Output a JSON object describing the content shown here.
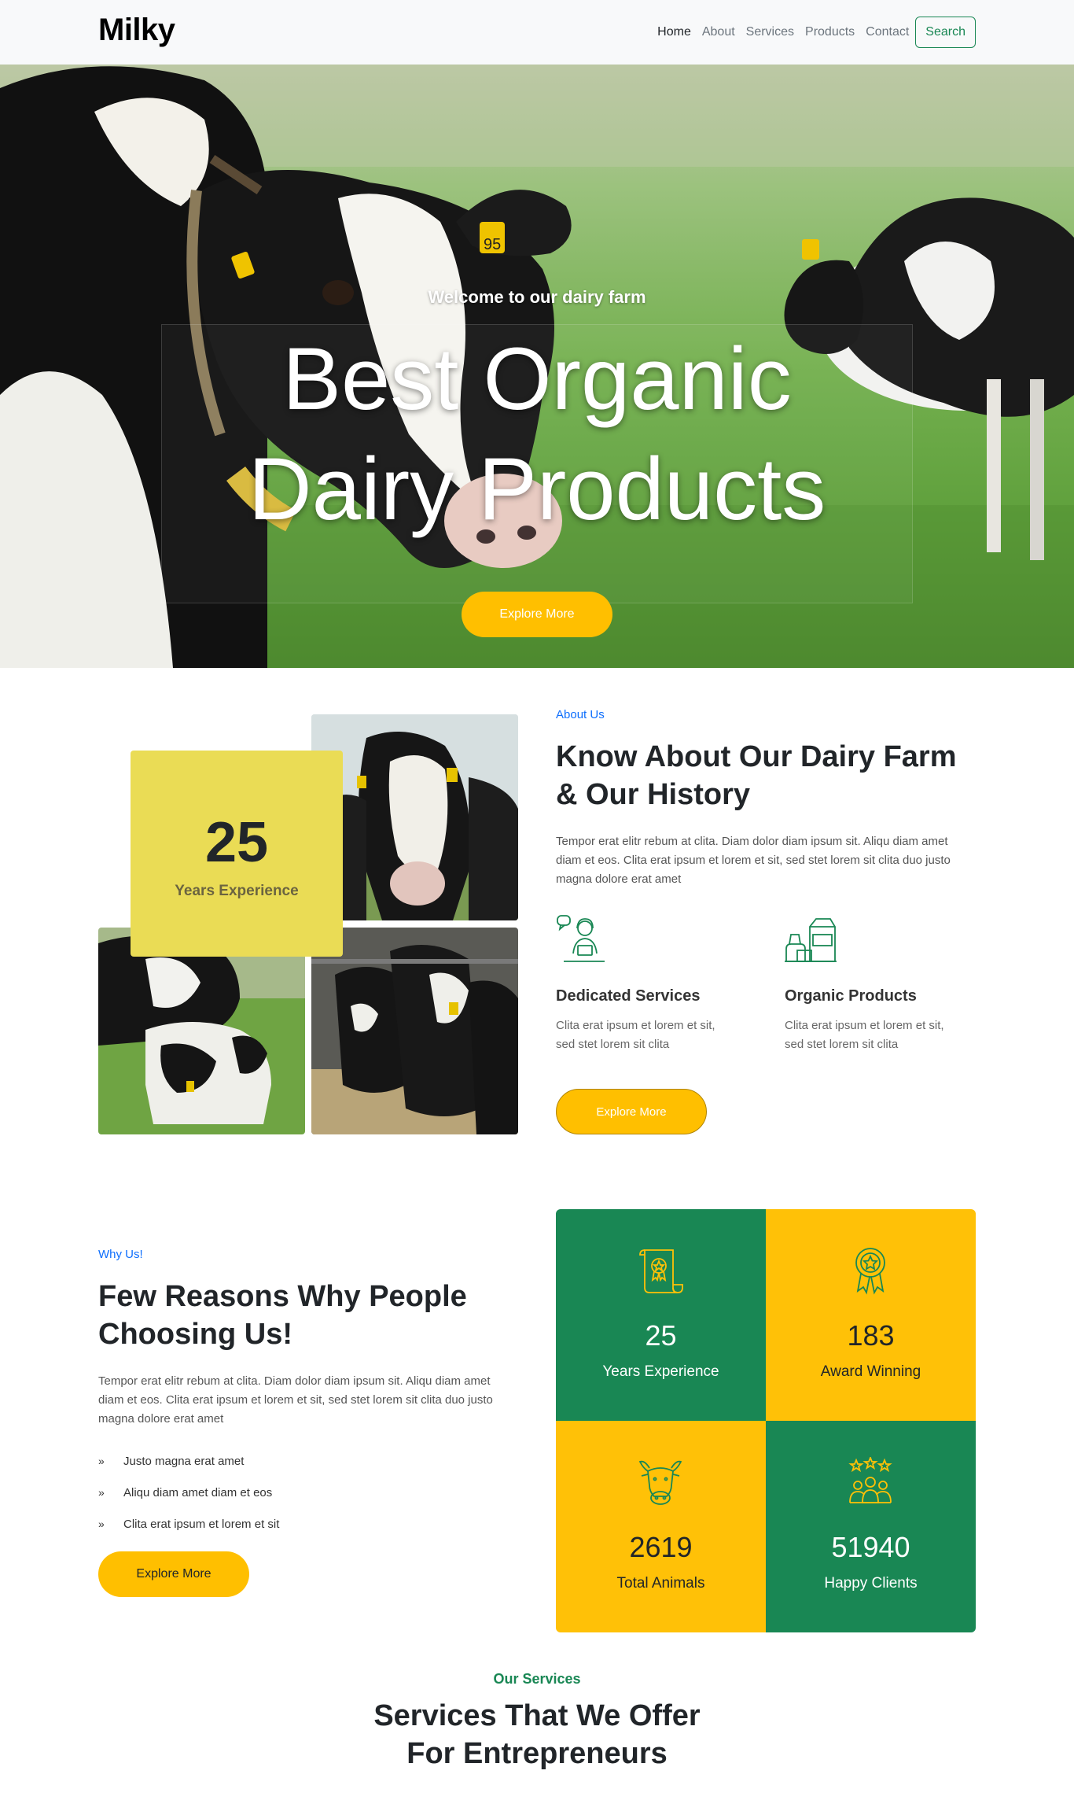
{
  "nav": {
    "brand": "Milky",
    "links": [
      "Home",
      "About",
      "Services",
      "Products",
      "Contact"
    ],
    "search_label": "Search"
  },
  "hero": {
    "subtitle": "Welcome to our dairy farm",
    "title_line1": "Best Organic",
    "title_line2": "Dairy Products",
    "button": "Explore More",
    "ear_tag_text": "95"
  },
  "about": {
    "tag": "About Us",
    "title_line1": "Know About Our Dairy Farm",
    "title_line2": "& Our History",
    "text": "Tempor erat elitr rebum at clita. Diam dolor diam ipsum sit. Aliqu diam amet diam et eos. Clita erat ipsum et lorem et sit, sed stet lorem sit clita duo justo magna dolore erat amet",
    "experience_number": "25",
    "experience_label": "Years Experience",
    "features": [
      {
        "title": "Dedicated Services",
        "text": "Clita erat ipsum et lorem et sit, sed stet lorem sit clita",
        "icon": "customer-support-icon"
      },
      {
        "title": "Organic Products",
        "text": "Clita erat ipsum et lorem et sit, sed stet lorem sit clita",
        "icon": "dairy-products-icon"
      }
    ],
    "button": "Explore More"
  },
  "why": {
    "tag": "Why Us!",
    "title_line1": "Few Reasons Why People",
    "title_line2": "Choosing Us!",
    "text": "Tempor erat elitr rebum at clita. Diam dolor diam ipsum sit. Aliqu diam amet diam et eos. Clita erat ipsum et lorem et sit, sed stet lorem sit clita duo justo magna dolore erat amet",
    "list": [
      "Justo magna erat amet",
      "Aliqu diam amet diam et eos",
      "Clita erat ipsum et lorem et sit"
    ],
    "button": "Explore More",
    "stats": [
      {
        "number": "25",
        "label": "Years Experience",
        "icon": "certificate-icon",
        "color": "#198754"
      },
      {
        "number": "183",
        "label": "Award Winning",
        "icon": "award-icon",
        "color": "#ffc107"
      },
      {
        "number": "2619",
        "label": "Total Animals",
        "icon": "cow-icon",
        "color": "#ffc107"
      },
      {
        "number": "51940",
        "label": "Happy Clients",
        "icon": "happy-clients-icon",
        "color": "#198754"
      }
    ]
  },
  "services": {
    "tag": "Our Services",
    "title_line1": "Services That We Offer",
    "title_line2": "For Entrepreneurs"
  },
  "colors": {
    "accent_yellow": "#ffbf00",
    "success_green": "#198754",
    "stat_yellow": "#ffc107",
    "experience_box": "#eadc55",
    "link_blue": "#0d6efd"
  }
}
